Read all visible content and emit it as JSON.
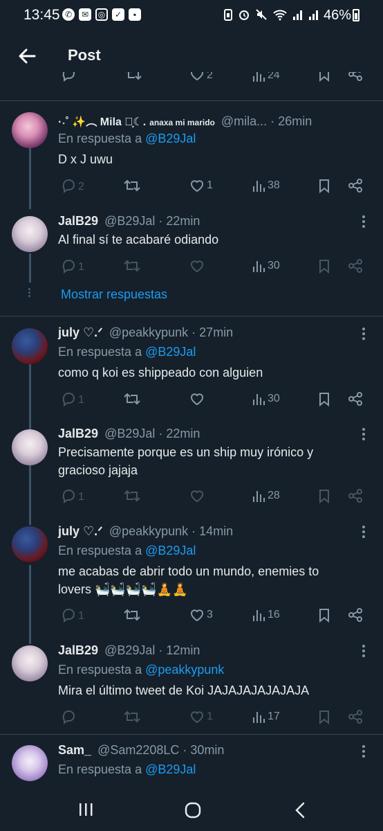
{
  "status": {
    "time": "13:45",
    "battery": "46%"
  },
  "header": {
    "title": "Post"
  },
  "top_partial": {
    "likes": "2",
    "views": "24"
  },
  "tweets": [
    {
      "display_name": "·˖˚ ✨︵ Mila ⋆͙☾.",
      "name_extra": "anaxa mi marido",
      "handle": "@mila...",
      "time": "· 26min",
      "reply_prefix": "En respuesta a",
      "reply_to": "@B29Jal",
      "text": "D x J uwu",
      "replies": "2",
      "retweets": "",
      "likes": "1",
      "views": "38"
    },
    {
      "display_name": "JalB29",
      "handle": "@B29Jal",
      "time": "· 22min",
      "text": "Al final sí te acabaré odiando",
      "replies": "1",
      "retweets": "",
      "likes": "",
      "views": "30"
    },
    {
      "display_name": "july ♡.ᐟ",
      "handle": "@peakkypunk",
      "time": "· 27min",
      "reply_prefix": "En respuesta a",
      "reply_to": "@B29Jal",
      "text": "como q koi es shippeado con alguien",
      "replies": "1",
      "retweets": "",
      "likes": "",
      "views": "30"
    },
    {
      "display_name": "JalB29",
      "handle": "@B29Jal",
      "time": "· 22min",
      "text_line1": "Precisamente porque es un ship muy irónico y",
      "text_line2": "gracioso jajaja",
      "replies": "1",
      "retweets": "",
      "likes": "",
      "views": "28"
    },
    {
      "display_name": "july ♡.ᐟ",
      "handle": "@peakkypunk",
      "time": "· 14min",
      "reply_prefix": "En respuesta a",
      "reply_to": "@B29Jal",
      "text_line1": "me acabas de abrir todo un mundo, enemies to",
      "text_line2": "lovers 🛀🛀🛀🛀🧘🧘",
      "replies": "1",
      "retweets": "",
      "likes": "3",
      "views": "16"
    },
    {
      "display_name": "JalB29",
      "handle": "@B29Jal",
      "time": "· 12min",
      "reply_prefix": "En respuesta a",
      "reply_to": "@peakkypunk",
      "text": "Mira el último tweet de Koi JAJAJAJAJAJAJA",
      "replies": "",
      "retweets": "",
      "likes": "1",
      "views": "17"
    },
    {
      "display_name": "Sam_",
      "handle": "@Sam2208LC",
      "time": "· 30min",
      "reply_prefix": "En respuesta a",
      "reply_to": "@B29Jal"
    }
  ],
  "show_replies": "Mostrar respuestas",
  "colors": {
    "background": "#15202b",
    "accent": "#1d9bf0",
    "secondary_text": "#8899a6"
  }
}
